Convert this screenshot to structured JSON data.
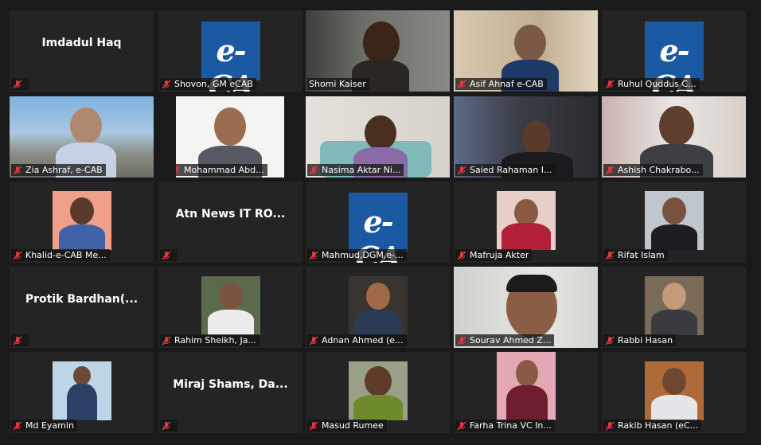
{
  "participants": [
    {
      "name": "Imdadul Haq",
      "display": "name"
    },
    {
      "name": "Shovon, GM eCAB",
      "display": "logo",
      "logo_text": "e-CA"
    },
    {
      "name": "Shomi Kaiser",
      "display": "video",
      "active": true
    },
    {
      "name": "Asif Ahnaf e-CAB",
      "display": "video"
    },
    {
      "name": "Ruhul Quddus C...",
      "display": "logo",
      "logo_text": "e-CA"
    },
    {
      "name": "Zia Ashraf, e-CAB",
      "display": "video"
    },
    {
      "name": "Mohammad Abd...",
      "display": "video"
    },
    {
      "name": "Nasima Aktar Ni...",
      "display": "video"
    },
    {
      "name": "Saied Rahaman I...",
      "display": "video"
    },
    {
      "name": "Ashish Chakrabo...",
      "display": "video"
    },
    {
      "name": "Khalid-e-CAB Me...",
      "display": "photo"
    },
    {
      "name": "Atn News IT RO...",
      "display": "name"
    },
    {
      "name": "Mahmud,DGM,e-...",
      "display": "logo",
      "logo_text": "e-CA"
    },
    {
      "name": "Mafruja Akter",
      "display": "photo"
    },
    {
      "name": "Rifat Islam",
      "display": "photo"
    },
    {
      "name": "Protik Bardhan(...",
      "display": "name"
    },
    {
      "name": "Rahim Sheikh, Ja...",
      "display": "photo"
    },
    {
      "name": "Adnan Ahmed (e...",
      "display": "photo"
    },
    {
      "name": "Sourav Ahmed Z...",
      "display": "video"
    },
    {
      "name": "Rabbi Hasan",
      "display": "photo"
    },
    {
      "name": "Md Eyamin",
      "display": "photo"
    },
    {
      "name": "Miraj Shams, Da...",
      "display": "name"
    },
    {
      "name": "Masud Rumee",
      "display": "photo"
    },
    {
      "name": "Farha Trina VC In...",
      "display": "photo"
    },
    {
      "name": "Rakib Hasan (eC...",
      "display": "photo"
    }
  ],
  "name_tiles": {
    "t0": "Imdadul Haq",
    "t11": "Atn News IT RO...",
    "t15": "Protik  Bardhan(...",
    "t21": "Miraj  Shams,  Da..."
  },
  "colors": {
    "active_border": "#c9e07a",
    "mic_muted": "#e0393e",
    "tile_bg": "#242424",
    "logo_blue": "#1b5aa3"
  },
  "icons": {
    "mic": "mic-muted-icon"
  }
}
